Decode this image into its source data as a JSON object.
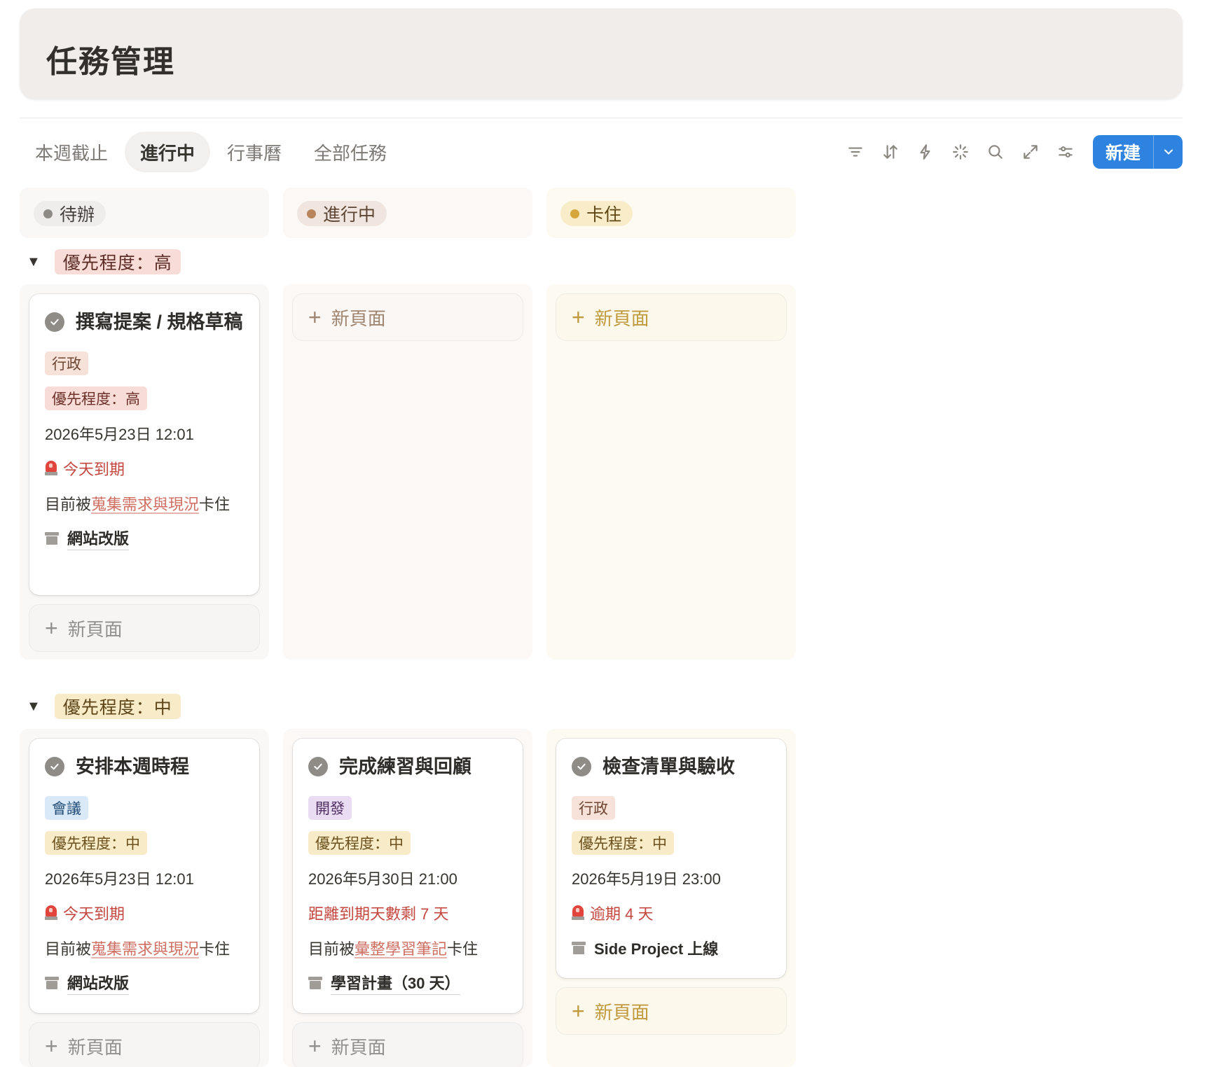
{
  "page": {
    "title": "任務管理"
  },
  "tabs": [
    "本週截止",
    "進行中",
    "行事曆",
    "全部任務"
  ],
  "toolbar": {
    "new_label": "新建"
  },
  "columns": [
    "待辦",
    "進行中",
    "卡住"
  ],
  "groups": {
    "high": "優先程度：高",
    "mid": "優先程度：中"
  },
  "add_label": "新頁面",
  "cards": {
    "h0": {
      "title": "撰寫提案 / 規格草稿",
      "tag": "行政",
      "priority": "優先程度：高",
      "date": "2026年5月23日 12:01",
      "due": "今天到期",
      "blocked_prefix": "目前被",
      "blocked_link": "蒐集需求與現況",
      "blocked_suffix": "卡住",
      "project": "網站改版"
    },
    "m0": {
      "title": "安排本週時程",
      "tag": "會議",
      "priority": "優先程度：中",
      "date": "2026年5月23日 12:01",
      "due": "今天到期",
      "blocked_prefix": "目前被",
      "blocked_link": "蒐集需求與現況",
      "blocked_suffix": "卡住",
      "project": "網站改版"
    },
    "m1": {
      "title": "完成練習與回顧",
      "tag": "開發",
      "priority": "優先程度：中",
      "date": "2026年5月30日 21:00",
      "due": "距離到期天數剩 7 天",
      "blocked_prefix": "目前被",
      "blocked_link": "彙整學習筆記",
      "blocked_suffix": "卡住",
      "project": "學習計畫（30 天）"
    },
    "m2": {
      "title": "檢查清單與驗收",
      "tag": "行政",
      "priority": "優先程度：中",
      "date": "2026年5月19日 23:00",
      "due": "逾期 4 天",
      "project": "Side Project 上線"
    }
  }
}
